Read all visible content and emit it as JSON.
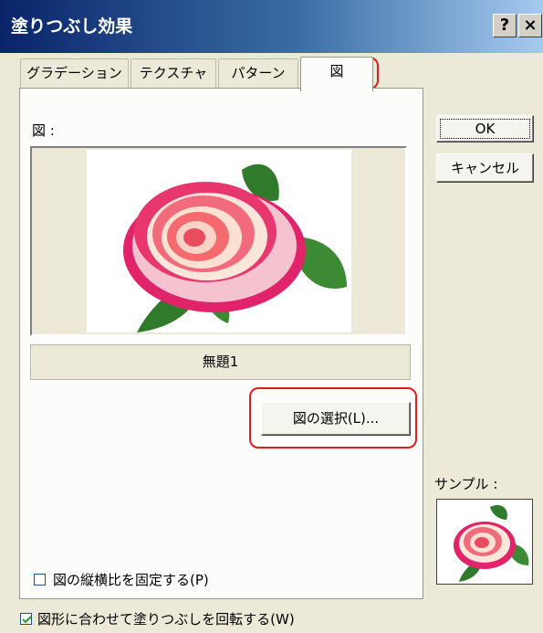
{
  "window": {
    "title": "塗りつぶし効果",
    "help_label": "?",
    "close_label": "×"
  },
  "tabs": [
    {
      "label": "グラデーション"
    },
    {
      "label": "テクスチャ"
    },
    {
      "label": "パターン"
    },
    {
      "label": "図",
      "active": true
    }
  ],
  "picture": {
    "label": "図 :",
    "name": "無題1",
    "select_button": "図の選択(L)..."
  },
  "lock_aspect": {
    "label": "図の縦横比を固定する(P)",
    "checked": false
  },
  "rotate_with_shape": {
    "label": "図形に合わせて塗りつぶしを回転する(W)",
    "checked": true
  },
  "buttons": {
    "ok": "OK",
    "cancel": "キャンセル"
  },
  "sample": {
    "label": "サンプル :"
  },
  "colors": {
    "highlight_box": "#e31b1b",
    "titlebar_start": "#0a246a",
    "face": "#ece9d8"
  },
  "icons": {
    "picture": "rose-image",
    "sample": "rose-thumbnail-image",
    "check": "checkmark-icon"
  }
}
